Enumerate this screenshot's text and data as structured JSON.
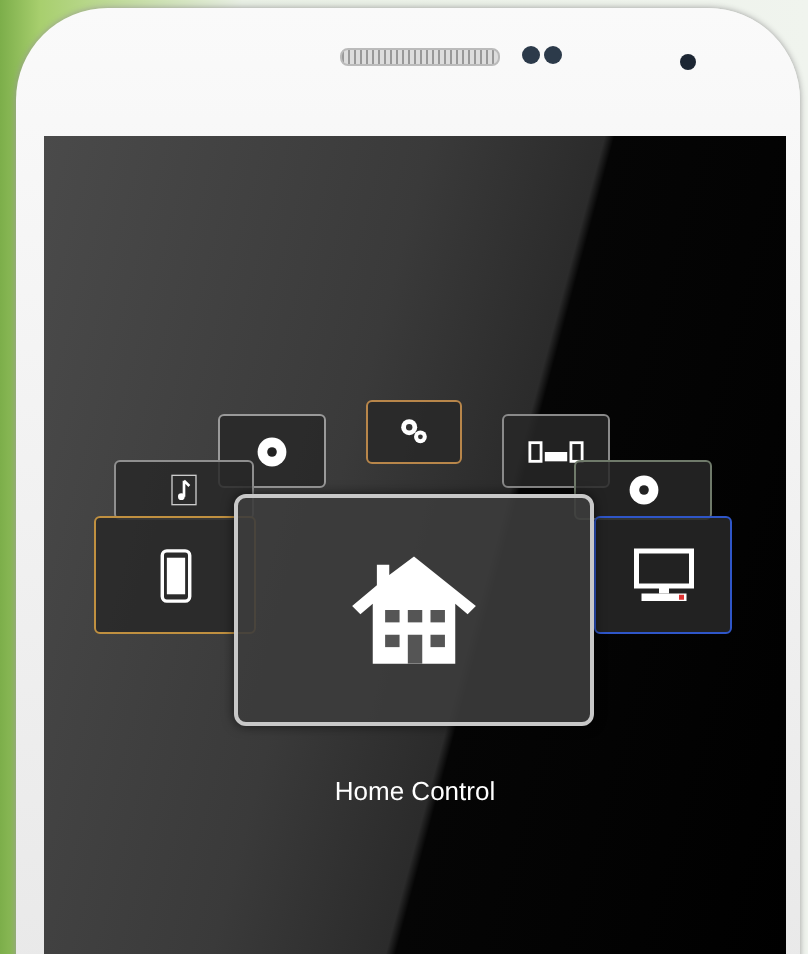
{
  "carousel": {
    "cards": [
      {
        "kind": "disc",
        "color": "#9a9a9a",
        "selected": false
      },
      {
        "kind": "gears",
        "color": "#b8864a",
        "selected": false
      },
      {
        "kind": "speakers",
        "color": "#8a8a8a",
        "selected": false
      },
      {
        "kind": "music",
        "color": "#8f8f8f",
        "selected": false
      },
      {
        "kind": "disc",
        "color": "#6f7a6a",
        "selected": false
      },
      {
        "kind": "phone",
        "color": "#c09040",
        "selected": false
      },
      {
        "kind": "monitor",
        "color": "#2f56c8",
        "selected": false
      },
      {
        "kind": "home",
        "color": "#c8c8c8",
        "selected": true
      }
    ],
    "caption": "Home Control"
  }
}
